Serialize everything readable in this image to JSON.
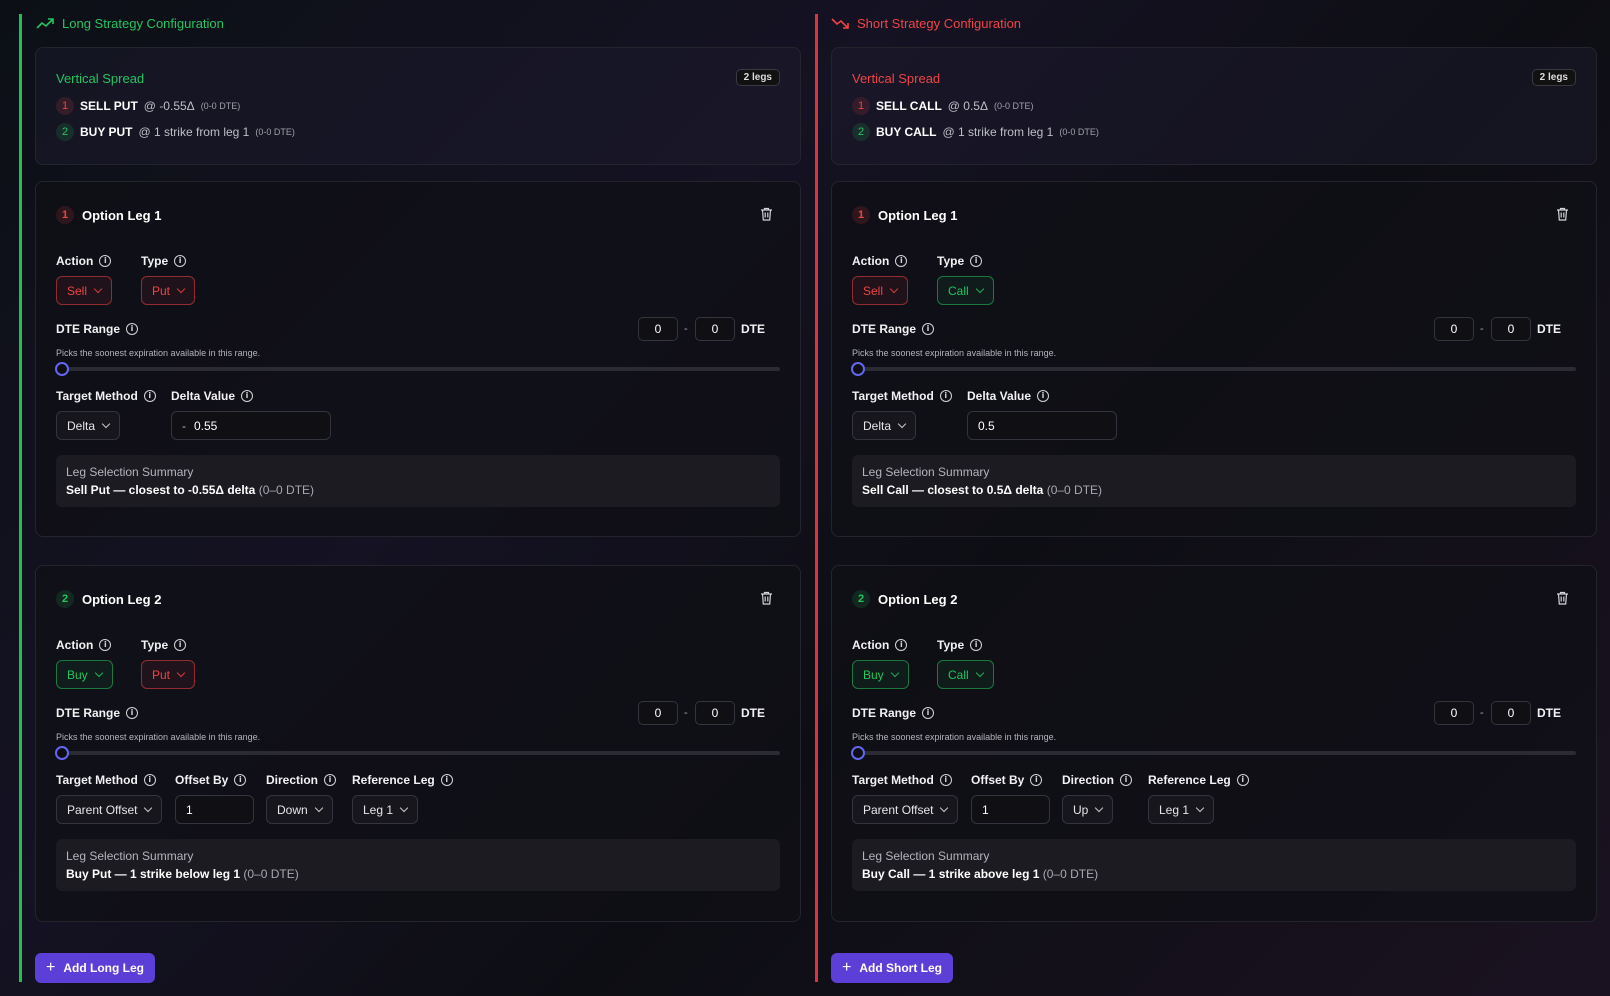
{
  "long": {
    "section_title": "Long Strategy Configuration",
    "strategy": {
      "name": "Vertical Spread",
      "legs_badge": "2 legs",
      "rows": [
        {
          "n": "1",
          "action": "SELL PUT",
          "at": "@ -0.55Δ",
          "dte": "(0-0 DTE)"
        },
        {
          "n": "2",
          "action": "BUY PUT",
          "at": "@ 1 strike from leg 1",
          "dte": "(0-0 DTE)"
        }
      ]
    },
    "leg1": {
      "num": "1",
      "title": "Option Leg 1",
      "action_label": "Action",
      "action_value": "Sell",
      "type_label": "Type",
      "type_value": "Put",
      "dte_label": "DTE Range",
      "dte_min": "0",
      "dte_max": "0",
      "dte_unit": "DTE",
      "hint": "Picks the soonest expiration available in this range.",
      "target_label": "Target Method",
      "target_value": "Delta",
      "delta_label": "Delta Value",
      "delta_sign": "-",
      "delta_value": "0.55",
      "summary_title": "Leg Selection Summary",
      "summary_bold": "Sell Put — closest to -0.55Δ delta",
      "summary_dte": "(0–0 DTE)"
    },
    "leg2": {
      "num": "2",
      "title": "Option Leg 2",
      "action_label": "Action",
      "action_value": "Buy",
      "type_label": "Type",
      "type_value": "Put",
      "dte_label": "DTE Range",
      "dte_min": "0",
      "dte_max": "0",
      "dte_unit": "DTE",
      "hint": "Picks the soonest expiration available in this range.",
      "target_label": "Target Method",
      "target_value": "Parent Offset",
      "offset_label": "Offset By",
      "offset_value": "1",
      "direction_label": "Direction",
      "direction_value": "Down",
      "ref_label": "Reference Leg",
      "ref_value": "Leg 1",
      "summary_title": "Leg Selection Summary",
      "summary_bold": "Buy Put — 1 strike below leg 1",
      "summary_dte": "(0–0 DTE)"
    },
    "add_label": "Add Long Leg"
  },
  "short": {
    "section_title": "Short Strategy Configuration",
    "strategy": {
      "name": "Vertical Spread",
      "legs_badge": "2 legs",
      "rows": [
        {
          "n": "1",
          "action": "SELL CALL",
          "at": "@ 0.5Δ",
          "dte": "(0-0 DTE)"
        },
        {
          "n": "2",
          "action": "BUY CALL",
          "at": "@ 1 strike from leg 1",
          "dte": "(0-0 DTE)"
        }
      ]
    },
    "leg1": {
      "num": "1",
      "title": "Option Leg 1",
      "action_label": "Action",
      "action_value": "Sell",
      "type_label": "Type",
      "type_value": "Call",
      "dte_label": "DTE Range",
      "dte_min": "0",
      "dte_max": "0",
      "dte_unit": "DTE",
      "hint": "Picks the soonest expiration available in this range.",
      "target_label": "Target Method",
      "target_value": "Delta",
      "delta_label": "Delta Value",
      "delta_value": "0.5",
      "summary_title": "Leg Selection Summary",
      "summary_bold": "Sell Call — closest to 0.5Δ delta",
      "summary_dte": "(0–0 DTE)"
    },
    "leg2": {
      "num": "2",
      "title": "Option Leg 2",
      "action_label": "Action",
      "action_value": "Buy",
      "type_label": "Type",
      "type_value": "Call",
      "dte_label": "DTE Range",
      "dte_min": "0",
      "dte_max": "0",
      "dte_unit": "DTE",
      "hint": "Picks the soonest expiration available in this range.",
      "target_label": "Target Method",
      "target_value": "Parent Offset",
      "offset_label": "Offset By",
      "offset_value": "1",
      "direction_label": "Direction",
      "direction_value": "Up",
      "ref_label": "Reference Leg",
      "ref_value": "Leg 1",
      "summary_title": "Leg Selection Summary",
      "summary_bold": "Buy Call — 1 strike above leg 1",
      "summary_dte": "(0–0 DTE)"
    },
    "add_label": "Add Short Leg"
  },
  "colors": {
    "long_accent": "#22c55e",
    "short_accent": "#ef4444",
    "button": "#5b3fd6",
    "slider": "#6366f1"
  },
  "icons": {
    "long": "trending-up-icon",
    "short": "trending-down-icon",
    "delete": "trash-icon",
    "info": "info-icon",
    "add": "plus-icon"
  }
}
